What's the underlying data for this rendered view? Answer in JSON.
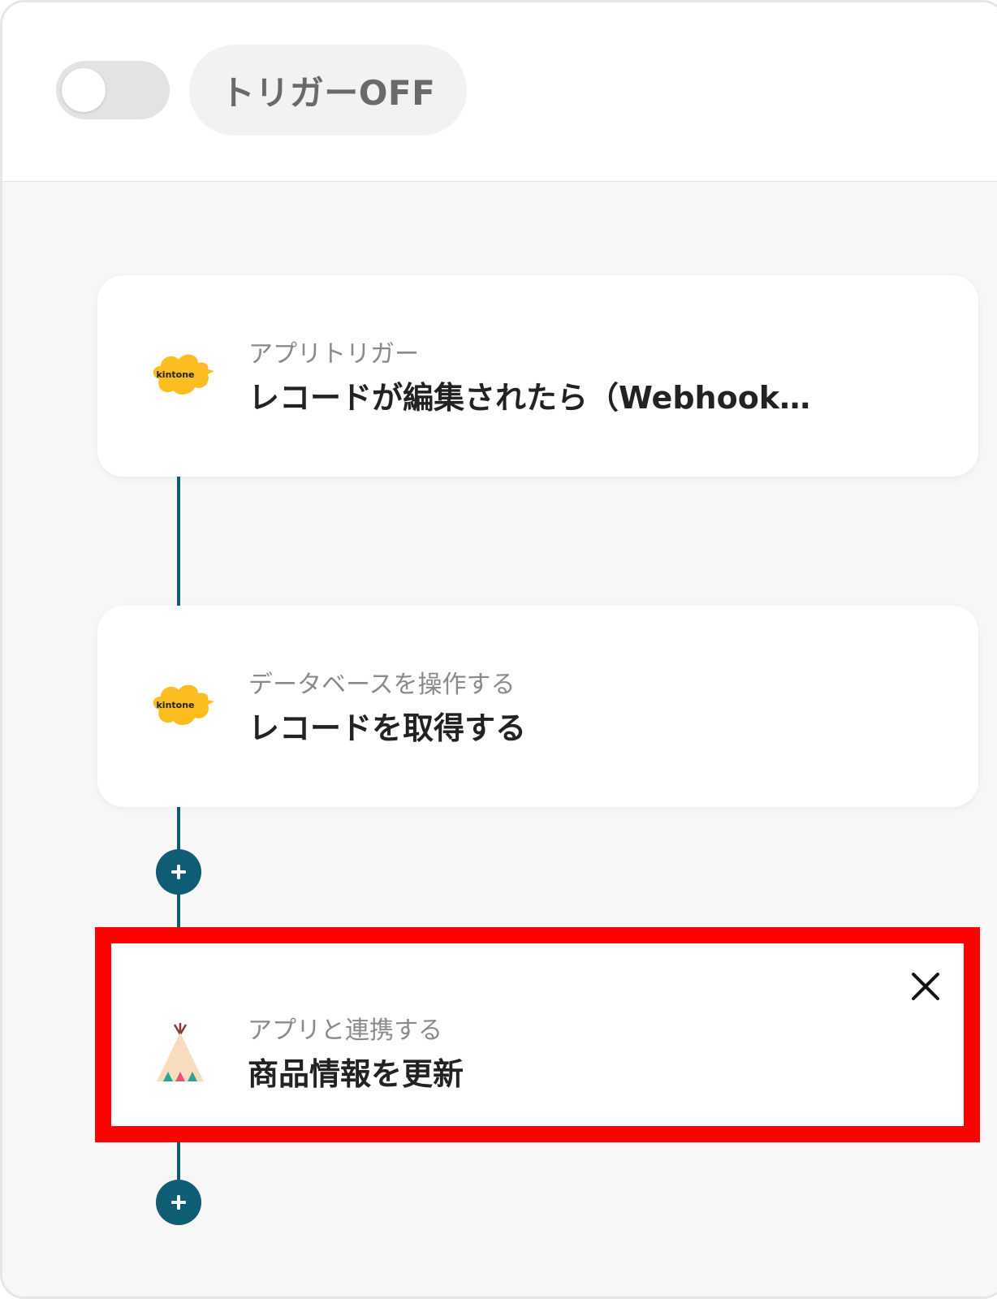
{
  "header": {
    "toggle_state": "off",
    "trigger_label": "トリガーOFF"
  },
  "steps": [
    {
      "app_icon": "kintone-logo",
      "subtitle": "アプリトリガー",
      "title": "レコードが編集されたら（Webhook…"
    },
    {
      "app_icon": "kintone-logo",
      "subtitle": "データベースを操作する",
      "title": "レコードを取得する"
    },
    {
      "app_icon": "teepee-logo",
      "subtitle": "アプリと連携する",
      "title": "商品情報を更新",
      "highlighted": true
    }
  ],
  "colors": {
    "connector": "#0f5c75",
    "highlight": "#ff0000",
    "kintone": "#fbbd1f"
  },
  "icons": {
    "add": "plus-icon",
    "close": "close-icon"
  }
}
